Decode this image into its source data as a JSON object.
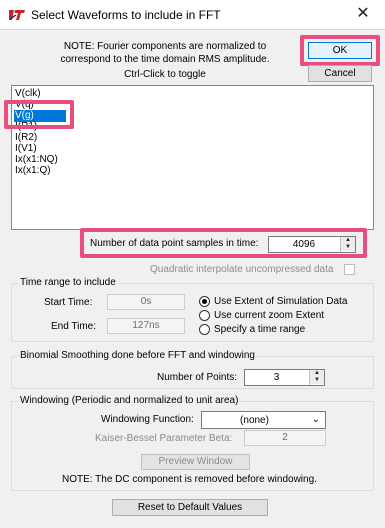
{
  "window": {
    "title": "Select Waveforms to include in FFT",
    "close_glyph": "✕"
  },
  "note": {
    "line1": "NOTE:  Fourier components are normalized to",
    "line2": "correspond to the time domain RMS amplitude.",
    "ctrl_click": "Ctrl-Click to toggle"
  },
  "buttons": {
    "ok": "OK",
    "cancel": "Cancel",
    "preview": "Preview Window",
    "reset": "Reset to Default Values"
  },
  "waveforms": {
    "items": [
      "V(clk)",
      "V(q)",
      "V(g)",
      "I(R1)",
      "I(R2)",
      "I(V1)",
      "Ix(x1:NQ)",
      "Ix(x1:Q)"
    ],
    "selected": "V(g)"
  },
  "samples": {
    "label": "Number of data point samples in time:",
    "value": "4096"
  },
  "quadratic": {
    "label": "Quadratic interpolate uncompressed data",
    "checked": false
  },
  "time_range": {
    "title": "Time range to include",
    "start_label": "Start Time:",
    "start_value": "0s",
    "end_label": "End Time:",
    "end_value": "127ns",
    "options": [
      "Use Extent of Simulation Data",
      "Use current zoom Extent",
      "Specify a time range"
    ],
    "selected_option": "Use Extent of Simulation Data"
  },
  "binomial": {
    "title": "Binomial Smoothing done before FFT and windowing",
    "points_label": "Number of Points:",
    "points_value": "3"
  },
  "windowing": {
    "title": "Windowing  (Periodic and normalized to unit area)",
    "function_label": "Windowing Function:",
    "function_value": "(none)",
    "beta_label": "Kaiser-Bessel Parameter Beta:",
    "beta_value": "2",
    "dc_note": "NOTE:  The DC component is removed before windowing."
  },
  "colors": {
    "highlight": "#e84d82",
    "selection": "#0078d7"
  }
}
